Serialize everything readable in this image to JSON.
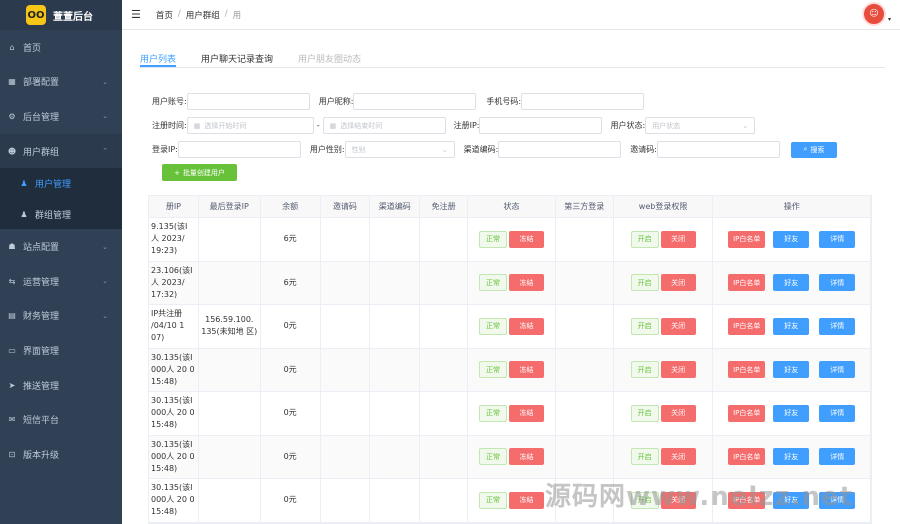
{
  "app": {
    "logo_text": "OO",
    "title": "萱萱后台"
  },
  "sidebar": {
    "items": [
      {
        "icon": "⌂",
        "label": "首页",
        "chevron": ""
      },
      {
        "icon": "▦",
        "label": "部署配置",
        "chevron": "⌄"
      },
      {
        "icon": "⚙",
        "label": "后台管理",
        "chevron": "⌄"
      },
      {
        "icon": "☻",
        "label": "用户群组",
        "chevron": "⌃"
      }
    ],
    "sub_items": [
      {
        "icon": "♟",
        "label": "用户管理"
      },
      {
        "icon": "♟",
        "label": "群组管理"
      }
    ],
    "items_after": [
      {
        "icon": "☗",
        "label": "站点配置",
        "chevron": "⌄"
      },
      {
        "icon": "⇆",
        "label": "运营管理",
        "chevron": "⌄"
      },
      {
        "icon": "▤",
        "label": "财务管理",
        "chevron": "⌄"
      },
      {
        "icon": "▭",
        "label": "界面管理",
        "chevron": ""
      },
      {
        "icon": "➤",
        "label": "推送管理",
        "chevron": ""
      },
      {
        "icon": "✉",
        "label": "短信平台",
        "chevron": ""
      },
      {
        "icon": "⊡",
        "label": "版本升级",
        "chevron": ""
      }
    ]
  },
  "topbar": {
    "hamburger": "☰",
    "crumbs": [
      "首页",
      "用户群组",
      "用"
    ],
    "sep": "/",
    "avatar": "☺",
    "caret": "▾"
  },
  "tabs": [
    "用户列表",
    "用户聊天记录查询",
    "用户朋友圈动态"
  ],
  "form": {
    "account_label": "用户账号:",
    "nickname_label": "用户昵称:",
    "phone_label": "手机号码:",
    "regtime_label": "注册时间:",
    "start_placeholder": "选择开始时间",
    "range_sep": "-",
    "end_placeholder": "选择结束时间",
    "regip_label": "注册IP:",
    "status_label": "用户状态:",
    "status_placeholder": "用户状态",
    "loginip_label": "登录IP:",
    "gender_label": "用户性别:",
    "gender_placeholder": "性别",
    "channel_label": "渠道编码:",
    "invite_label": "邀请码:",
    "search_button": "搜索",
    "batch_button": "批量创建用户",
    "calendar_icon": "▦",
    "search_icon": "⌕",
    "plus_icon": "+",
    "select_caret": "⌄"
  },
  "table": {
    "headers": [
      "册IP",
      "最后登录IP",
      "余额",
      "邀请码",
      "渠道编码",
      "免注册",
      "状态",
      "第三方登录",
      "web登录权限",
      "操作"
    ],
    "rows": [
      {
        "reg_ip": "9.135(该I 人 2023/ 19:23)",
        "last_ip": "",
        "balance": "6元",
        "status_a": "正常",
        "status_b": "冻结",
        "web_a": "开启",
        "web_b": "关闭"
      },
      {
        "reg_ip": "23.106(该I 人 2023/ 17:32)",
        "last_ip": "",
        "balance": "6元",
        "status_a": "正常",
        "status_b": "冻结",
        "web_a": "开启",
        "web_b": "关闭"
      },
      {
        "reg_ip": "IP共注册 /04/10 1 07)",
        "last_ip": "156.59.100. 135(未知地 区)",
        "balance": "0元",
        "status_a": "正常",
        "status_b": "冻结",
        "web_a": "开启",
        "web_b": "关闭"
      },
      {
        "reg_ip": "30.135(该I 000人 20 0 15:48)",
        "last_ip": "",
        "balance": "0元",
        "status_a": "正常",
        "status_b": "冻结",
        "web_a": "开启",
        "web_b": "关闭"
      },
      {
        "reg_ip": "30.135(该I 000人 20 0 15:48)",
        "last_ip": "",
        "balance": "0元",
        "status_a": "正常",
        "status_b": "冻结",
        "web_a": "开启",
        "web_b": "关闭"
      },
      {
        "reg_ip": "30.135(该I 000人 20 0 15:48)",
        "last_ip": "",
        "balance": "0元",
        "status_a": "正常",
        "status_b": "冻结",
        "web_a": "开启",
        "web_b": "关闭"
      },
      {
        "reg_ip": "30.135(该I 000人 20 0 15:48)",
        "last_ip": "",
        "balance": "0元",
        "status_a": "正常",
        "status_b": "冻结",
        "web_a": "开启",
        "web_b": "关闭"
      }
    ],
    "op_whitelist": "IP白名单",
    "op_friend": "好友",
    "op_detail": "详情"
  },
  "watermark": "源码网www.nelzz.net",
  "colors": {
    "sidebar": "#304156",
    "primary": "#409eff",
    "danger": "#f56c6c",
    "success": "#67c23a",
    "logo": "#f5c518"
  }
}
